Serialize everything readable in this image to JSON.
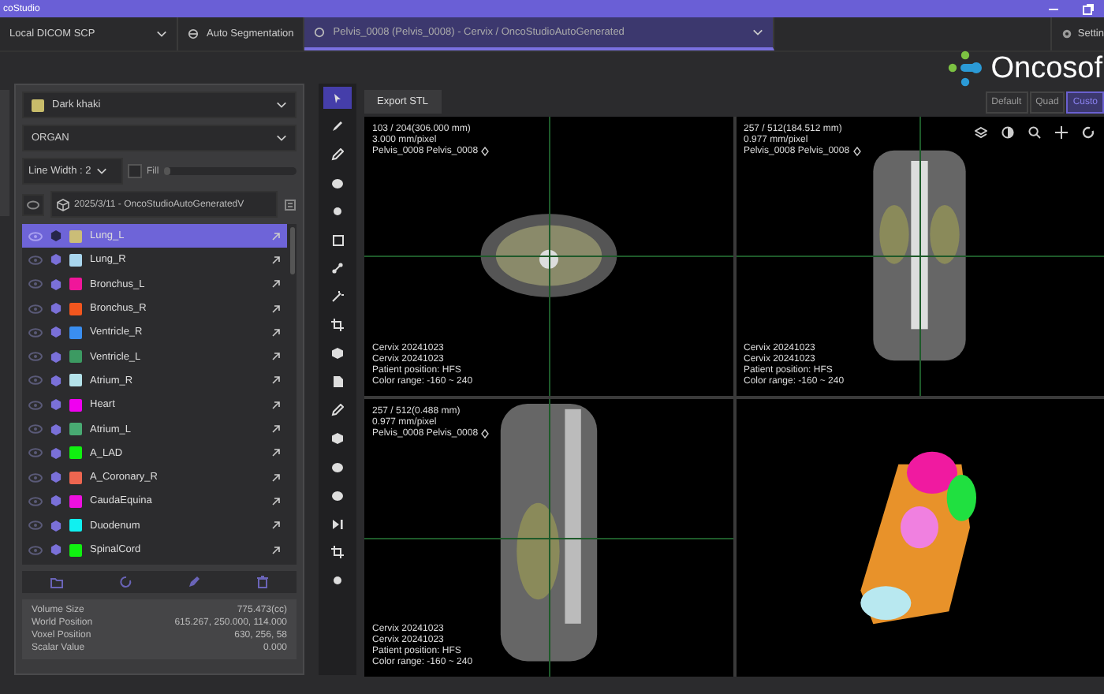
{
  "window": {
    "title": "coStudio"
  },
  "tabs": [
    {
      "label": "Local DICOM SCP",
      "kind": "source",
      "selected": false
    },
    {
      "label": "Auto Segmentation",
      "kind": "tool",
      "selected": false
    },
    {
      "label": "Pelvis_0008 (Pelvis_0008) - Cervix / OncoStudioAutoGenerated",
      "kind": "study",
      "selected": true
    }
  ],
  "settings": {
    "label": "Settin"
  },
  "logo": {
    "text": "Oncosof"
  },
  "layouts": [
    {
      "label": "Default",
      "selected": false
    },
    {
      "label": "Quad",
      "selected": false
    },
    {
      "label": "Custo",
      "selected": true
    }
  ],
  "export_button": "Export STL",
  "panel": {
    "color_select": {
      "value": "Dark khaki",
      "color": "#c8bc6a"
    },
    "type_select": {
      "value": "ORGAN"
    },
    "line_width": {
      "value": "Line Width : 2"
    },
    "fill": {
      "label": "Fill",
      "checked": false,
      "level": 0.04
    },
    "structure_set": {
      "value": "2025/3/11 - OncoStudioAutoGeneratedV"
    },
    "structures": [
      {
        "name": "Lung_L",
        "color": "#cbbd77",
        "selected": true
      },
      {
        "name": "Lung_R",
        "color": "#a9d6ee",
        "selected": false
      },
      {
        "name": "Bronchus_L",
        "color": "#f0169a",
        "selected": false
      },
      {
        "name": "Bronchus_R",
        "color": "#f2561e",
        "selected": false
      },
      {
        "name": "Ventricle_R",
        "color": "#3a8ef0",
        "selected": false
      },
      {
        "name": "Ventricle_L",
        "color": "#3c9a62",
        "selected": false
      },
      {
        "name": "Atrium_R",
        "color": "#b4e2ea",
        "selected": false
      },
      {
        "name": "Heart",
        "color": "#f000f0",
        "selected": false
      },
      {
        "name": "Atrium_L",
        "color": "#48aa72",
        "selected": false
      },
      {
        "name": "A_LAD",
        "color": "#10f010",
        "selected": false
      },
      {
        "name": "A_Coronary_R",
        "color": "#ee6650",
        "selected": false
      },
      {
        "name": "CaudaEquina",
        "color": "#ee10e0",
        "selected": false
      },
      {
        "name": "Duodenum",
        "color": "#10f0f0",
        "selected": false
      },
      {
        "name": "SpinalCord",
        "color": "#10f010",
        "selected": false
      }
    ],
    "info": [
      {
        "label": "Volume Size",
        "value": "775.473(cc)"
      },
      {
        "label": "World Position",
        "value": "615.267, 250.000, 114.000"
      },
      {
        "label": "Voxel Position",
        "value": "630, 256, 58"
      },
      {
        "label": "Scalar Value",
        "value": "0.000"
      }
    ]
  },
  "tools": [
    {
      "kind": "pointer",
      "selected": true
    },
    {
      "kind": "brush",
      "selected": false
    },
    {
      "kind": "pen",
      "selected": false
    },
    {
      "kind": "blob",
      "selected": false
    },
    {
      "kind": "dot",
      "selected": false
    },
    {
      "kind": "square",
      "selected": false
    },
    {
      "kind": "node",
      "selected": false
    },
    {
      "kind": "magic",
      "selected": false
    },
    {
      "kind": "crop",
      "selected": false
    },
    {
      "kind": "cube",
      "selected": false
    },
    {
      "kind": "page",
      "selected": false
    },
    {
      "kind": "pen",
      "selected": false
    },
    {
      "kind": "cube",
      "selected": false
    },
    {
      "kind": "blob",
      "selected": false
    },
    {
      "kind": "blob",
      "selected": false
    },
    {
      "kind": "skip",
      "selected": false
    },
    {
      "kind": "crop",
      "selected": false
    },
    {
      "kind": "dot",
      "selected": false
    }
  ],
  "views": [
    {
      "kind": "axial",
      "top": [
        "103 / 204(306.000 mm)",
        "3.000 mm/pixel",
        "Pelvis_0008 Pelvis_0008"
      ],
      "bottom": [
        "Cervix 20241023",
        "Cervix 20241023",
        "Patient position: HFS",
        "Color range: -160 ~ 240"
      ],
      "toolbar": false
    },
    {
      "kind": "coronal",
      "top": [
        "257 / 512(184.512 mm)",
        "0.977 mm/pixel",
        "Pelvis_0008 Pelvis_0008"
      ],
      "bottom": [
        "Cervix 20241023",
        "Cervix 20241023",
        "Patient position: HFS",
        "Color range: -160 ~ 240"
      ],
      "toolbar": true
    },
    {
      "kind": "sagittal",
      "top": [
        "257 / 512(0.488 mm)",
        "0.977 mm/pixel",
        "Pelvis_0008 Pelvis_0008"
      ],
      "bottom": [
        "Cervix 20241023",
        "Cervix 20241023",
        "Patient position: HFS",
        "Color range: -160 ~ 240"
      ],
      "toolbar": false
    },
    {
      "kind": "render3d",
      "toolbar": false
    }
  ]
}
